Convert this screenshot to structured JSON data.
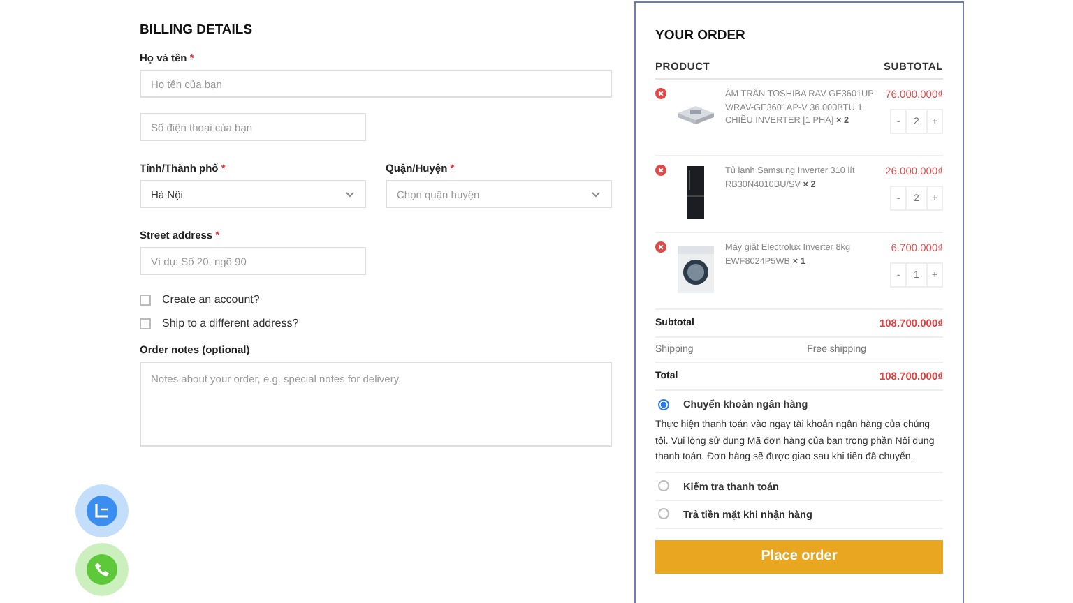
{
  "billing": {
    "title": "BILLING DETAILS",
    "fields": [
      {
        "kind": "wide",
        "label": "Họ và tên",
        "required_mark": "*",
        "placeholder": "Họ tên của bạn"
      },
      {
        "kind": "input",
        "placeholder": "Số điện thoại của bạn"
      },
      {
        "kind": "pair",
        "items": [
          {
            "label": "Tỉnh/Thành phố",
            "required_mark": "*",
            "value": "Hà Nội"
          },
          {
            "label": "Quận/Huyện",
            "required_mark": "*",
            "placeholder": "Chọn quận huyện"
          }
        ]
      },
      {
        "kind": "input",
        "label": "Street address",
        "required_mark": "*",
        "placeholder": "Ví dụ: Số 20, ngõ 90"
      }
    ],
    "checkboxes": [
      {
        "label": "Create an account?",
        "checked": false
      },
      {
        "label": "Ship to a different address?",
        "checked": false
      }
    ],
    "notes": {
      "label": "Order notes (optional)",
      "placeholder": "Notes about your order, e.g. special notes for delivery."
    }
  },
  "order": {
    "title": "YOUR ORDER",
    "columns": [
      "PRODUCT",
      "SUBTOTAL"
    ],
    "items": [
      {
        "kind": "ac",
        "name": "ÂM TRẦN TOSHIBA RAV-GE3601UP-V/RAV-GE3601AP-V 36.000BTU 1 CHIỀU INVERTER [1 PHA]",
        "qty_label": "× 2",
        "price": "76.000.000₫",
        "minus": "-",
        "qty": "2",
        "plus": "+"
      },
      {
        "kind": "fridge",
        "name": "Tủ lạnh Samsung Inverter 310 lít RB30N4010BU/SV",
        "qty_label": "× 2",
        "price": "26.000.000₫",
        "minus": "-",
        "qty": "2",
        "plus": "+"
      },
      {
        "kind": "washer",
        "name": "Máy giặt Electrolux Inverter 8kg EWF8024P5WB",
        "qty_label": "× 1",
        "price": "6.700.000₫",
        "minus": "-",
        "qty": "1",
        "plus": "+"
      }
    ],
    "subtotal": {
      "label": "Subtotal",
      "value": "108.700.000₫"
    },
    "shipping": {
      "label": "Shipping",
      "value": "Free shipping"
    },
    "total": {
      "label": "Total",
      "value": "108.700.000₫"
    },
    "payments": [
      {
        "label": "Chuyển khoản ngân hàng",
        "selected": true,
        "description": "Thực hiện thanh toán vào ngay tài khoản ngân hàng của chúng tôi. Vui lòng sử dụng Mã đơn hàng của bạn trong phần Nội dung thanh toán. Đơn hàng sẽ được giao sau khi tiền đã chuyển."
      },
      {
        "label": "Kiểm tra thanh toán",
        "selected": false
      },
      {
        "label": "Trả tiền mặt khi nhận hàng",
        "selected": false
      }
    ],
    "button": "Place order"
  }
}
